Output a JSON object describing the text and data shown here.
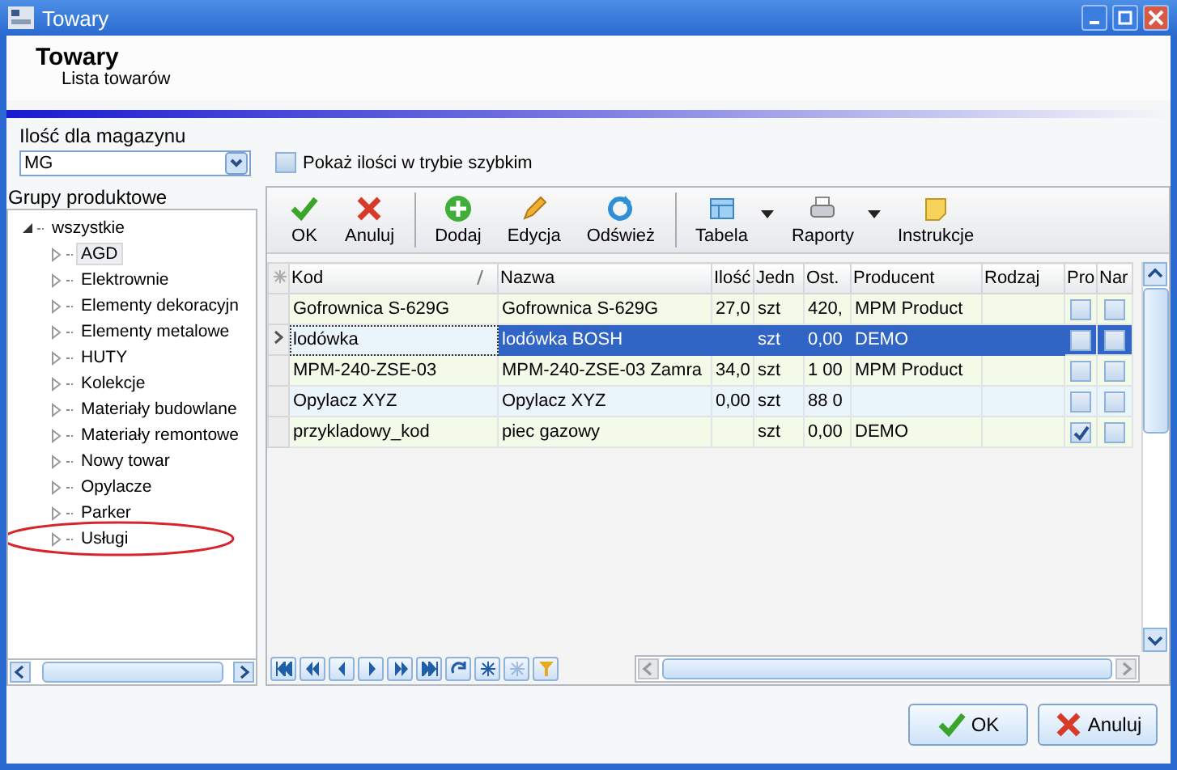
{
  "window": {
    "title": "Towary"
  },
  "header": {
    "title": "Towary",
    "subtitle": "Lista towarów"
  },
  "warehouse": {
    "label": "Ilość dla magazynu",
    "value": "MG"
  },
  "quick_mode": {
    "label": "Pokaż ilości w trybie szybkim",
    "checked": false
  },
  "groups": {
    "title": "Grupy produktowe",
    "tree": [
      {
        "label": "wszystkie",
        "expanded": true,
        "selected": false,
        "highlighted": false,
        "children": [
          {
            "label": "AGD",
            "expanded": false,
            "selected": true,
            "highlighted": false
          },
          {
            "label": "Elektrownie",
            "expanded": false,
            "selected": false,
            "highlighted": false
          },
          {
            "label": "Elementy dekoracyjn",
            "expanded": false,
            "selected": false,
            "highlighted": false
          },
          {
            "label": "Elementy metalowe",
            "expanded": false,
            "selected": false,
            "highlighted": false
          },
          {
            "label": "HUTY",
            "expanded": false,
            "selected": false,
            "highlighted": false
          },
          {
            "label": "Kolekcje",
            "expanded": false,
            "selected": false,
            "highlighted": false
          },
          {
            "label": "Materiały budowlane",
            "expanded": false,
            "selected": false,
            "highlighted": false
          },
          {
            "label": "Materiały remontowe",
            "expanded": false,
            "selected": false,
            "highlighted": false
          },
          {
            "label": "Nowy towar",
            "expanded": false,
            "selected": false,
            "highlighted": false
          },
          {
            "label": "Opylacze",
            "expanded": false,
            "selected": false,
            "highlighted": false
          },
          {
            "label": "Parker",
            "expanded": false,
            "selected": false,
            "highlighted": false
          },
          {
            "label": "Usługi",
            "expanded": false,
            "selected": false,
            "highlighted": true
          }
        ]
      }
    ]
  },
  "toolbar": [
    {
      "kind": "ok",
      "label": "OK",
      "dropdown": false
    },
    {
      "kind": "cancel",
      "label": "Anuluj",
      "dropdown": false
    },
    {
      "kind": "separator"
    },
    {
      "kind": "add",
      "label": "Dodaj",
      "dropdown": false
    },
    {
      "kind": "edit",
      "label": "Edycja",
      "dropdown": false
    },
    {
      "kind": "refresh",
      "label": "Odśwież",
      "dropdown": false
    },
    {
      "kind": "separator"
    },
    {
      "kind": "table",
      "label": "Tabela",
      "dropdown": true
    },
    {
      "kind": "print",
      "label": "Raporty",
      "dropdown": true
    },
    {
      "kind": "note",
      "label": "Instrukcje",
      "dropdown": false
    }
  ],
  "table": {
    "columns": [
      "Kod",
      "Nazwa",
      "Ilość",
      "Jedn",
      "Ost.",
      "Producent",
      "Rodzaj",
      "Pro",
      "Nar"
    ],
    "rows": [
      {
        "kod": "Gofrownica S-629G",
        "nazwa": "Gofrownica S-629G",
        "ilosc": "27,0",
        "jedn": "szt",
        "ost": "420,",
        "producent": "MPM Product",
        "pro": false,
        "nar": false,
        "selected": false
      },
      {
        "kod": "lodówka",
        "nazwa": "lodówka BOSH",
        "jedn": "szt",
        "ost": "0,00",
        "producent": "DEMO",
        "pro": false,
        "nar": false,
        "selected": true
      },
      {
        "kod": "MPM-240-ZSE-03",
        "nazwa": "MPM-240-ZSE-03 Zamra",
        "ilosc": "34,0",
        "jedn": "szt",
        "ost": "1 00",
        "producent": "MPM Product",
        "pro": false,
        "nar": false,
        "selected": false
      },
      {
        "kod": "Opylacz XYZ",
        "nazwa": "Opylacz XYZ",
        "ilosc": "0,00",
        "jedn": "szt",
        "ost": "88 0",
        "pro": false,
        "nar": false,
        "selected": false
      },
      {
        "kod": "przykladowy_kod",
        "nazwa": "piec gazowy",
        "jedn": "szt",
        "ost": "0,00",
        "producent": "DEMO",
        "pro": true,
        "nar": false,
        "selected": false
      }
    ]
  },
  "navigator": [
    {
      "kind": "first",
      "disabled": false
    },
    {
      "kind": "prev-page",
      "disabled": false
    },
    {
      "kind": "prev",
      "disabled": false
    },
    {
      "kind": "next",
      "disabled": false
    },
    {
      "kind": "next-page",
      "disabled": false
    },
    {
      "kind": "last",
      "disabled": false
    },
    {
      "kind": "refresh",
      "disabled": false
    },
    {
      "kind": "new",
      "disabled": false
    },
    {
      "kind": "new",
      "disabled": true
    },
    {
      "kind": "filter",
      "disabled": false
    }
  ],
  "buttons": [
    {
      "kind": "ok",
      "label": "OK"
    },
    {
      "kind": "cancel",
      "label": "Anuluj"
    }
  ]
}
